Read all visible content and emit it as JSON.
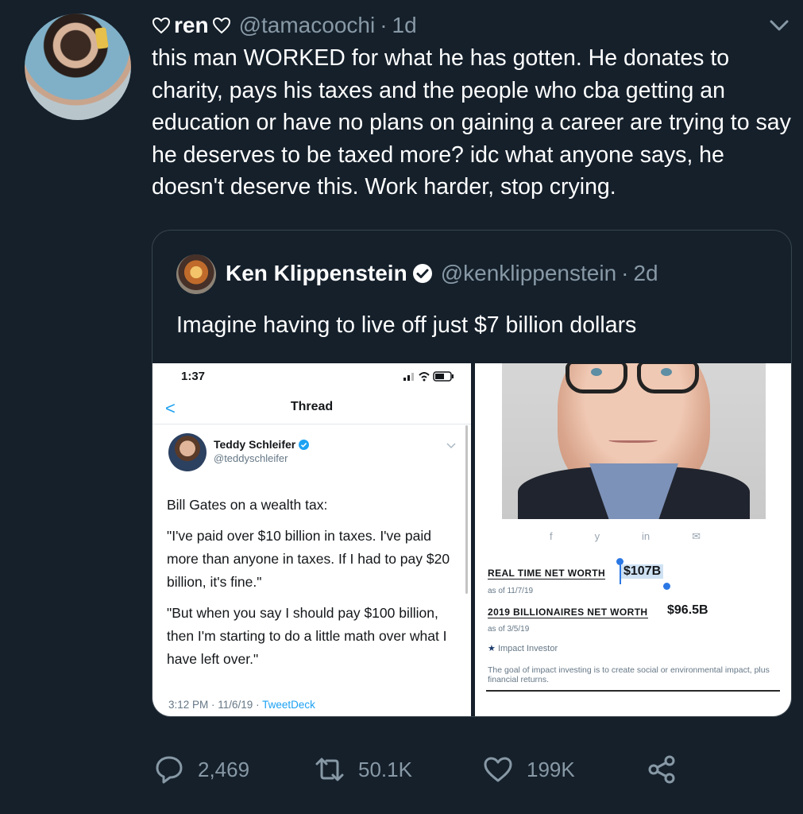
{
  "tweet": {
    "display_name": "ren",
    "handle": "@tamacoochi",
    "separator": "·",
    "time": "1d",
    "text": "this man WORKED for what he has gotten. He donates to charity, pays his taxes and the people who cba getting an education or have no plans on gaining a career are trying to say he deserves to be taxed more? idc what anyone says, he doesn't deserve this. Work harder, stop crying."
  },
  "quote": {
    "display_name": "Ken Klippenstein",
    "handle": "@kenklippenstein",
    "separator": "·",
    "time": "2d",
    "text": "Imagine having to live off just $7 billion dollars"
  },
  "left_image": {
    "status_time": "1:37",
    "back": "<",
    "title": "Thread",
    "author_name": "Teddy Schleifer",
    "author_handle": "@teddyschleifer",
    "paragraphs": [
      "Bill Gates on a wealth tax:",
      "\"I've paid over $10 billion in taxes. I've paid more than anyone in taxes. If I had to pay $20 billion, it's fine.\"",
      "\"But when you say I should pay $100 billion, then I'm starting to do a little math over what I have left over.\""
    ],
    "footer_time": "3:12 PM · 11/6/19 · ",
    "footer_app": "TweetDeck"
  },
  "right_image": {
    "share_icons": [
      "f",
      "y",
      "in",
      "✉"
    ],
    "real_time_label": "REAL TIME NET WORTH",
    "real_time_value": "$107B",
    "real_time_asof": "as of 11/7/19",
    "billionaires_label": "2019 BILLIONAIRES NET WORTH",
    "billionaires_value": "$96.5B",
    "billionaires_asof": "as of 3/5/19",
    "impact_star": "★",
    "impact_label": "Impact Investor",
    "goal_text": "The goal of impact investing is to create social or environmental impact, plus financial returns."
  },
  "actions": {
    "replies": "2,469",
    "retweets": "50.1K",
    "likes": "199K"
  },
  "colors": {
    "background": "#15202b",
    "secondary_text": "#8899a6",
    "border": "#38444d",
    "accent": "#1da1f2"
  }
}
